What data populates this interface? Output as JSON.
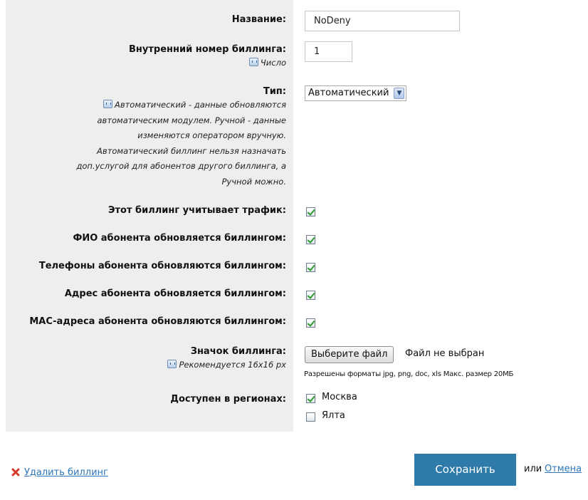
{
  "form": {
    "name": {
      "label": "Название:",
      "value": "NoDeny"
    },
    "internal_number": {
      "label": "Внутренний номер биллинга:",
      "hint": "Число",
      "value": "1"
    },
    "type": {
      "label": "Тип:",
      "hint_lines": [
        "Автоматический - данные обновляются",
        "автоматическим модулем. Ручной - данные",
        "изменяются оператором вручную.",
        "Автоматический биллинг нельзя назначать",
        "доп.услугой для абонентов другого биллинга, а",
        "Ручной можно."
      ],
      "selected": "Автоматический"
    },
    "checkboxes": [
      {
        "label": "Этот биллинг учитывает трафик:",
        "checked": true
      },
      {
        "label": "ФИО абонента обновляется биллингом:",
        "checked": true
      },
      {
        "label": "Телефоны абонента обновляются биллингом:",
        "checked": true
      },
      {
        "label": "Адрес абонента обновляется биллингом:",
        "checked": true
      },
      {
        "label": "MAC-адреса абонента обновляются биллингом:",
        "checked": true
      }
    ],
    "icon": {
      "label": "Значок биллинга:",
      "hint": "Рекомендуется 16x16 px",
      "button_label": "Выберите файл",
      "status": "Файл не выбран",
      "note": "Разрешены форматы jpg, png, doc, xls Макс. размер 20МБ"
    },
    "regions": {
      "label": "Доступен в регионах:",
      "items": [
        {
          "name": "Москва",
          "checked": true
        },
        {
          "name": "Ялта",
          "checked": false
        }
      ]
    }
  },
  "actions": {
    "save_label": "Сохранить",
    "or_text": "или",
    "cancel_label": "Отмена",
    "delete_label": "Удалить биллинг"
  }
}
